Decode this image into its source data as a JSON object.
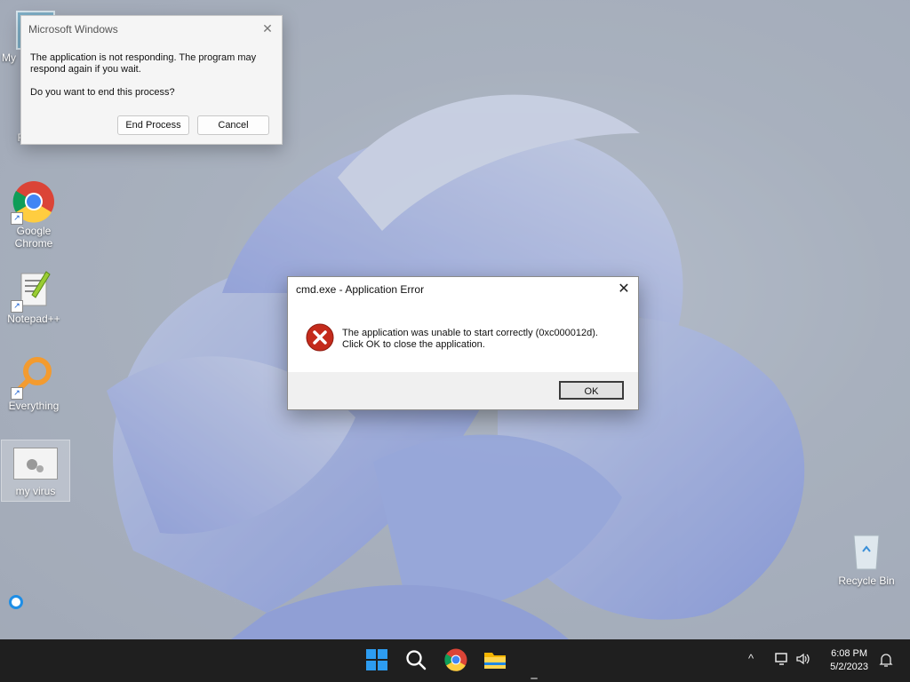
{
  "desktop": {
    "icons": [
      {
        "label": "My"
      },
      {
        "label": "Firefox"
      },
      {
        "label": "Google Chrome"
      },
      {
        "label": "Notepad++"
      },
      {
        "label": "Everything"
      },
      {
        "label": "my virus"
      },
      {
        "label": "Recycle Bin"
      }
    ]
  },
  "not_responding_dialog": {
    "title": "Microsoft Windows",
    "message": "The application is not responding. The program may respond again if you wait.",
    "question": "Do you want to end this process?",
    "end_process_label": "End Process",
    "cancel_label": "Cancel",
    "close_glyph": "✕"
  },
  "error_dialog": {
    "title": "cmd.exe - Application Error",
    "message_line1": "The application was unable to start correctly (0xc000012d).",
    "message_line2": "Click OK to close the application.",
    "ok_label": "OK",
    "close_glyph": "✕",
    "icon": "error-icon"
  },
  "taskbar": {
    "apps": [
      "start-icon",
      "search-icon",
      "chrome-icon",
      "file-explorer-icon"
    ],
    "tray": {
      "chevron": "^",
      "time": "6:08 PM",
      "date": "5/2/2023"
    }
  },
  "colors": {
    "taskbar": "#1f1f1f",
    "error_red": "#c42b1c",
    "ok_border": "#3b3b3b"
  }
}
